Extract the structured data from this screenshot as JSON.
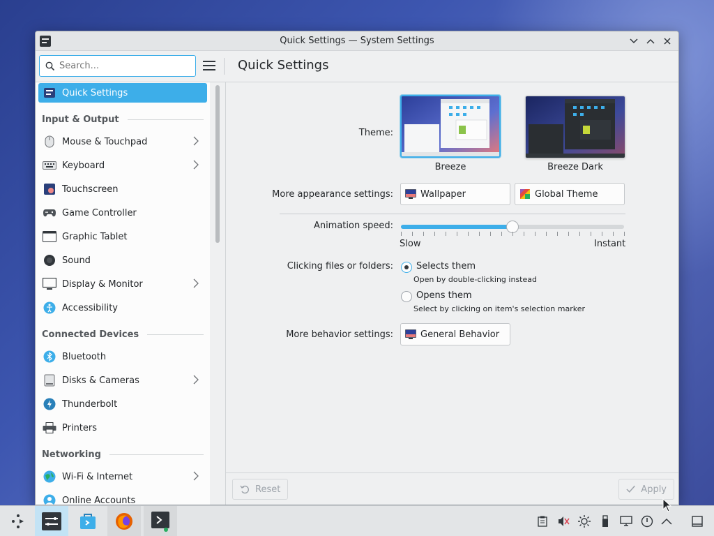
{
  "window": {
    "title": "Quick Settings — System Settings"
  },
  "search": {
    "placeholder": "Search...",
    "value": ""
  },
  "page_title": "Quick Settings",
  "sidebar": {
    "active": "Quick Settings",
    "categories": {
      "input_output": "Input & Output",
      "connected_devices": "Connected Devices",
      "networking": "Networking"
    },
    "items": [
      {
        "label": "Quick Settings"
      },
      {
        "label": "Mouse & Touchpad"
      },
      {
        "label": "Keyboard"
      },
      {
        "label": "Touchscreen"
      },
      {
        "label": "Game Controller"
      },
      {
        "label": "Graphic Tablet"
      },
      {
        "label": "Sound"
      },
      {
        "label": "Display & Monitor"
      },
      {
        "label": "Accessibility"
      },
      {
        "label": "Bluetooth"
      },
      {
        "label": "Disks & Cameras"
      },
      {
        "label": "Thunderbolt"
      },
      {
        "label": "Printers"
      },
      {
        "label": "Wi-Fi & Internet"
      },
      {
        "label": "Online Accounts"
      }
    ]
  },
  "content": {
    "theme_label": "Theme:",
    "themes": [
      {
        "name": "Breeze",
        "selected": true
      },
      {
        "name": "Breeze Dark",
        "selected": false
      }
    ],
    "appearance_label": "More appearance settings:",
    "wallpaper_button": "Wallpaper",
    "global_theme_button": "Global Theme",
    "animation_label": "Animation speed:",
    "animation_value": 0.5,
    "slider_min_label": "Slow",
    "slider_max_label": "Instant",
    "clicking_label": "Clicking files or folders:",
    "option_selects": "Selects them",
    "option_selects_hint": "Open by double-clicking instead",
    "option_opens": "Opens them",
    "option_opens_hint": "Select by clicking on item's selection marker",
    "behavior_label": "More behavior settings:",
    "general_behavior_button": "General Behavior"
  },
  "footer": {
    "reset": "Reset",
    "apply": "Apply"
  },
  "colors": {
    "accent": "#3daee9",
    "window_bg": "#eff0f1",
    "sidebar_bg": "#fcfcfc"
  }
}
